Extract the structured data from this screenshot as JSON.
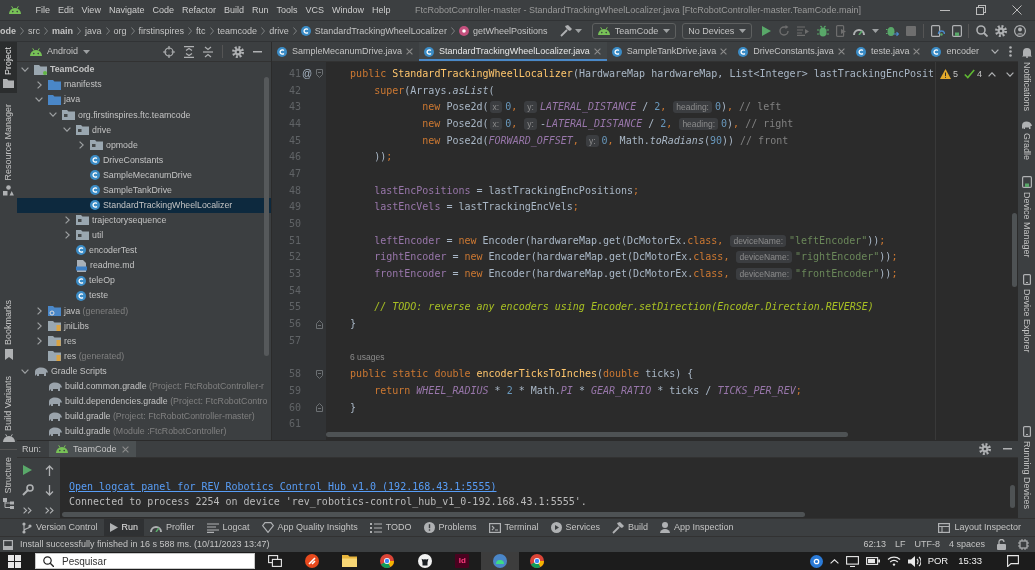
{
  "menu_bar": {
    "menus": [
      "File",
      "Edit",
      "View",
      "Navigate",
      "Code",
      "Refactor",
      "Build",
      "Run",
      "Tools",
      "VCS",
      "Window",
      "Help"
    ],
    "title": "FtcRobotController-master - StandardTrackingWheelLocalizer.java [FtcRobotController-master.TeamCode.main]"
  },
  "navigation_bar": {
    "breadcrumbs": [
      {
        "label": "ode",
        "kind": "folder",
        "bold": true
      },
      {
        "label": "src",
        "kind": "folder",
        "bold": false
      },
      {
        "label": "main",
        "kind": "folder",
        "bold": true
      },
      {
        "label": "java",
        "kind": "folder",
        "bold": false
      },
      {
        "label": "org",
        "kind": "folder",
        "bold": false
      },
      {
        "label": "firstinspires",
        "kind": "folder",
        "bold": false
      },
      {
        "label": "ftc",
        "kind": "folder",
        "bold": false
      },
      {
        "label": "teamcode",
        "kind": "folder",
        "bold": false
      },
      {
        "label": "drive",
        "kind": "folder",
        "bold": false
      },
      {
        "label": "StandardTrackingWheelLocalizer",
        "kind": "class",
        "bold": false
      },
      {
        "label": "getWheelPositions",
        "kind": "method",
        "bold": false
      }
    ],
    "run_configuration": "TeamCode",
    "device": "No Devices"
  },
  "left_stripe": {
    "top": [
      {
        "label": "Project",
        "kind": "folder",
        "selected": true
      },
      {
        "label": "Resource Manager",
        "kind": "resources",
        "selected": false
      }
    ],
    "middle": [
      {
        "label": "Bookmarks",
        "kind": "bookmark",
        "selected": false
      },
      {
        "label": "Build Variants",
        "kind": "android",
        "selected": false
      }
    ],
    "bottom": [
      {
        "label": "Structure",
        "kind": "structure",
        "selected": false
      }
    ]
  },
  "right_stripe": {
    "top": [
      {
        "label": "Notifications",
        "kind": "bell",
        "selected": false
      }
    ],
    "middle": [
      {
        "label": "Gradle",
        "kind": "gradle",
        "selected": false
      },
      {
        "label": "Device Manager",
        "kind": "device",
        "selected": false
      },
      {
        "label": "Device Explorer",
        "kind": "phone",
        "selected": false
      }
    ],
    "bottom": [
      {
        "label": "Running Devices",
        "kind": "phone",
        "selected": false
      }
    ]
  },
  "project_panel": {
    "view": "Android",
    "tree": [
      {
        "label": "TeamCode",
        "kind": "module",
        "expanded": true,
        "selected": false,
        "children": [
          {
            "label": "manifests",
            "kind": "source_folder",
            "expanded": false,
            "selected": false
          },
          {
            "label": "java",
            "kind": "source_folder",
            "expanded": true,
            "selected": false,
            "children": [
              {
                "label": "org.firstinspires.ftc.teamcode",
                "kind": "package",
                "expanded": true,
                "selected": false,
                "children": [
                  {
                    "label": "drive",
                    "kind": "package",
                    "expanded": true,
                    "selected": false,
                    "children": [
                      {
                        "label": "opmode",
                        "kind": "package",
                        "expanded": false,
                        "selected": false
                      },
                      {
                        "label": "DriveConstants",
                        "kind": "class",
                        "selected": false
                      },
                      {
                        "label": "SampleMecanumDrive",
                        "kind": "class",
                        "selected": false
                      },
                      {
                        "label": "SampleTankDrive",
                        "kind": "class",
                        "selected": false
                      },
                      {
                        "label": "StandardTrackingWheelLocalizer",
                        "kind": "class",
                        "selected": true
                      }
                    ]
                  },
                  {
                    "label": "trajectorysequence",
                    "kind": "package",
                    "expanded": false,
                    "selected": false
                  },
                  {
                    "label": "util",
                    "kind": "package",
                    "expanded": false,
                    "selected": false
                  },
                  {
                    "label": "encoderTest",
                    "kind": "class",
                    "selected": false
                  },
                  {
                    "label": "readme.md",
                    "kind": "markdown",
                    "selected": false
                  },
                  {
                    "label": "teleOp",
                    "kind": "class",
                    "selected": false
                  },
                  {
                    "label": "teste",
                    "kind": "class",
                    "selected": false
                  }
                ]
              }
            ]
          },
          {
            "label": "java",
            "note": "(generated)",
            "kind": "generated_folder",
            "expanded": false,
            "selected": false
          },
          {
            "label": "jniLibs",
            "kind": "resource_folder",
            "expanded": false,
            "selected": false
          },
          {
            "label": "res",
            "kind": "resource_folder",
            "expanded": false,
            "selected": false
          },
          {
            "label": "res",
            "note": "(generated)",
            "kind": "resource_folder",
            "selected": false
          }
        ]
      },
      {
        "label": "Gradle Scripts",
        "kind": "gradle",
        "expanded": true,
        "selected": false,
        "children": [
          {
            "label": "build.common.gradle",
            "note": "(Project: FtcRobotController-r",
            "kind": "gradle",
            "selected": false
          },
          {
            "label": "build.dependencies.gradle",
            "note": "(Project: FtcRobotContro",
            "kind": "gradle",
            "selected": false
          },
          {
            "label": "build.gradle",
            "note": "(Project: FtcRobotController-master)",
            "kind": "gradle",
            "selected": false
          },
          {
            "label": "build.gradle",
            "note": "(Module :FtcRobotController)",
            "kind": "gradle",
            "selected": false
          }
        ]
      }
    ]
  },
  "editor": {
    "tabs": [
      {
        "label": "SampleMecanumDrive.java",
        "selected": false,
        "closable": true
      },
      {
        "label": "StandardTrackingWheelLocalizer.java",
        "selected": true,
        "closable": true
      },
      {
        "label": "SampleTankDrive.java",
        "selected": false,
        "closable": true
      },
      {
        "label": "DriveConstants.java",
        "selected": false,
        "closable": true
      },
      {
        "label": "teste.java",
        "selected": false,
        "closable": true
      },
      {
        "label": "encoder",
        "selected": false,
        "closable": false
      }
    ],
    "inspections": {
      "warnings": "5",
      "typos": "4"
    },
    "lines": [
      {
        "kind": "code",
        "number": "41",
        "gutter_icon": "@",
        "fold_start": true,
        "parts": [
          {
            "kind": "keyword",
            "text": "    public "
          },
          {
            "kind": "method",
            "text": "StandardTrackingWheelLocalizer"
          },
          {
            "kind": "plain",
            "text": "(HardwareMap hardwareMap, List<Integer> lastTrackingEncPosit"
          }
        ]
      },
      {
        "kind": "code",
        "number": "42",
        "parts": [
          {
            "kind": "keyword",
            "text": "        super"
          },
          {
            "kind": "plain",
            "text": "(Arrays."
          },
          {
            "kind": "italic",
            "text": "asList"
          },
          {
            "kind": "plain",
            "text": "("
          }
        ]
      },
      {
        "kind": "code",
        "number": "43",
        "parts": [
          {
            "kind": "keyword",
            "text": "                new"
          },
          {
            "kind": "plain",
            "text": " Pose2d("
          },
          {
            "kind": "hint",
            "text": "x:"
          },
          {
            "kind": "number",
            "text": "0"
          },
          {
            "kind": "punct",
            "text": ", "
          },
          {
            "kind": "hint",
            "text": "y:"
          },
          {
            "kind": "constant",
            "text": "LATERAL_DISTANCE"
          },
          {
            "kind": "plain",
            "text": " / "
          },
          {
            "kind": "number",
            "text": "2"
          },
          {
            "kind": "punct",
            "text": ", "
          },
          {
            "kind": "hint",
            "text": "heading:"
          },
          {
            "kind": "number",
            "text": "0"
          },
          {
            "kind": "plain",
            "text": ")"
          },
          {
            "kind": "punct",
            "text": ","
          },
          {
            "kind": "comment",
            "text": " // left"
          }
        ]
      },
      {
        "kind": "code",
        "number": "44",
        "parts": [
          {
            "kind": "keyword",
            "text": "                new"
          },
          {
            "kind": "plain",
            "text": " Pose2d("
          },
          {
            "kind": "hint",
            "text": "x:"
          },
          {
            "kind": "number",
            "text": "0"
          },
          {
            "kind": "punct",
            "text": ", "
          },
          {
            "kind": "hint",
            "text": "y:"
          },
          {
            "kind": "plain",
            "text": "-"
          },
          {
            "kind": "constant",
            "text": "LATERAL_DISTANCE"
          },
          {
            "kind": "plain",
            "text": " / "
          },
          {
            "kind": "number",
            "text": "2"
          },
          {
            "kind": "punct",
            "text": ", "
          },
          {
            "kind": "hint",
            "text": "heading:"
          },
          {
            "kind": "number",
            "text": "0"
          },
          {
            "kind": "plain",
            "text": ")"
          },
          {
            "kind": "punct",
            "text": ","
          },
          {
            "kind": "comment",
            "text": " // right"
          }
        ]
      },
      {
        "kind": "code",
        "number": "45",
        "parts": [
          {
            "kind": "keyword",
            "text": "                new"
          },
          {
            "kind": "plain",
            "text": " Pose2d("
          },
          {
            "kind": "constant",
            "text": "FORWARD_OFFSET"
          },
          {
            "kind": "punct",
            "text": ", "
          },
          {
            "kind": "hint",
            "text": "y:"
          },
          {
            "kind": "number",
            "text": "0"
          },
          {
            "kind": "punct",
            "text": ","
          },
          {
            "kind": "plain",
            "text": " Math."
          },
          {
            "kind": "italic",
            "text": "toRadians"
          },
          {
            "kind": "plain",
            "text": "("
          },
          {
            "kind": "number",
            "text": "90"
          },
          {
            "kind": "plain",
            "text": "))"
          },
          {
            "kind": "comment",
            "text": " // front"
          }
        ]
      },
      {
        "kind": "code",
        "number": "46",
        "parts": [
          {
            "kind": "plain",
            "text": "        ))"
          },
          {
            "kind": "punct",
            "text": ";"
          }
        ]
      },
      {
        "kind": "code",
        "number": "47"
      },
      {
        "kind": "code",
        "number": "48",
        "parts": [
          {
            "kind": "field",
            "text": "        lastEncPositions"
          },
          {
            "kind": "plain",
            "text": " = lastTrackingEncPositions"
          },
          {
            "kind": "punct",
            "text": ";"
          }
        ]
      },
      {
        "kind": "code",
        "number": "49",
        "parts": [
          {
            "kind": "field",
            "text": "        lastEncVels"
          },
          {
            "kind": "plain",
            "text": " = lastTrackingEncVels"
          },
          {
            "kind": "punct",
            "text": ";"
          }
        ]
      },
      {
        "kind": "code",
        "number": "50"
      },
      {
        "kind": "code",
        "number": "51",
        "parts": [
          {
            "kind": "field",
            "text": "        leftEncoder"
          },
          {
            "kind": "plain",
            "text": " = "
          },
          {
            "kind": "keyword",
            "text": "new"
          },
          {
            "kind": "plain",
            "text": " Encoder(hardwareMap.get(DcMotorEx."
          },
          {
            "kind": "keyword",
            "text": "class"
          },
          {
            "kind": "punct",
            "text": ", "
          },
          {
            "kind": "hint",
            "text": "deviceName:"
          },
          {
            "kind": "string",
            "text": "\"leftEncoder\""
          },
          {
            "kind": "plain",
            "text": "))"
          },
          {
            "kind": "punct",
            "text": ";"
          }
        ]
      },
      {
        "kind": "code",
        "number": "52",
        "parts": [
          {
            "kind": "field",
            "text": "        rightEncoder"
          },
          {
            "kind": "plain",
            "text": " = "
          },
          {
            "kind": "keyword",
            "text": "new"
          },
          {
            "kind": "plain",
            "text": " Encoder(hardwareMap.get(DcMotorEx."
          },
          {
            "kind": "keyword",
            "text": "class"
          },
          {
            "kind": "punct",
            "text": ", "
          },
          {
            "kind": "hint",
            "text": "deviceName:"
          },
          {
            "kind": "string",
            "text": "\"rightEncoder\""
          },
          {
            "kind": "plain",
            "text": "))"
          },
          {
            "kind": "punct",
            "text": ";"
          }
        ]
      },
      {
        "kind": "code",
        "number": "53",
        "parts": [
          {
            "kind": "field",
            "text": "        frontEncoder"
          },
          {
            "kind": "plain",
            "text": " = "
          },
          {
            "kind": "keyword",
            "text": "new"
          },
          {
            "kind": "plain",
            "text": " Encoder(hardwareMap.get(DcMotorEx."
          },
          {
            "kind": "keyword",
            "text": "class"
          },
          {
            "kind": "punct",
            "text": ", "
          },
          {
            "kind": "hint",
            "text": "deviceName:"
          },
          {
            "kind": "string",
            "text": "\"frontEncoder\""
          },
          {
            "kind": "plain",
            "text": "))"
          },
          {
            "kind": "punct",
            "text": ";"
          }
        ]
      },
      {
        "kind": "code",
        "number": "54"
      },
      {
        "kind": "code",
        "number": "55",
        "parts": [
          {
            "kind": "todo",
            "text": "        // TODO: reverse any encoders using Encoder.setDirection(Encoder.Direction.REVERSE)"
          }
        ]
      },
      {
        "kind": "code",
        "number": "56",
        "fold_end": true,
        "parts": [
          {
            "kind": "plain",
            "text": "    }"
          }
        ]
      },
      {
        "kind": "code",
        "number": "57"
      },
      {
        "kind": "usages",
        "text": "6 usages"
      },
      {
        "kind": "code",
        "number": "58",
        "fold_start": true,
        "parts": [
          {
            "kind": "keyword",
            "text": "    public static double "
          },
          {
            "kind": "method",
            "text": "encoderTicksToInches"
          },
          {
            "kind": "plain",
            "text": "("
          },
          {
            "kind": "keyword",
            "text": "double"
          },
          {
            "kind": "plain",
            "text": " ticks) {"
          }
        ]
      },
      {
        "kind": "code",
        "number": "59",
        "parts": [
          {
            "kind": "keyword",
            "text": "        return "
          },
          {
            "kind": "constant",
            "text": "WHEEL_RADIUS"
          },
          {
            "kind": "plain",
            "text": " * "
          },
          {
            "kind": "number",
            "text": "2"
          },
          {
            "kind": "plain",
            "text": " * Math."
          },
          {
            "kind": "constant",
            "text": "PI"
          },
          {
            "kind": "plain",
            "text": " * "
          },
          {
            "kind": "constant",
            "text": "GEAR_RATIO"
          },
          {
            "kind": "plain",
            "text": " * ticks / "
          },
          {
            "kind": "constant",
            "text": "TICKS_PER_REV"
          },
          {
            "kind": "punct",
            "text": ";"
          }
        ]
      },
      {
        "kind": "code",
        "number": "60",
        "fold_end": true,
        "parts": [
          {
            "kind": "plain",
            "text": "    }"
          }
        ]
      },
      {
        "kind": "code",
        "number": "61"
      }
    ]
  },
  "run_panel": {
    "title": "Run:",
    "tabs": [
      {
        "label": "TeamCode",
        "selected": true
      }
    ],
    "console": [
      {
        "kind": "link",
        "text": "Open logcat panel for REV Robotics Control Hub v1.0 (192.168.43.1:5555)"
      },
      {
        "kind": "output",
        "text": "Connected to process 2254 on device 'rev_robotics-control_hub_v1_0-192.168.43.1:5555'."
      }
    ]
  },
  "tool_windows": {
    "left": [
      {
        "label": "Version Control",
        "kind": "vcs",
        "selected": false
      },
      {
        "label": "Run",
        "kind": "run",
        "selected": true
      },
      {
        "label": "Profiler",
        "kind": "profiler",
        "selected": false
      },
      {
        "label": "Logcat",
        "kind": "logcat",
        "selected": false
      },
      {
        "label": "App Quality Insights",
        "kind": "insights",
        "selected": false
      },
      {
        "label": "TODO",
        "kind": "todo",
        "selected": false
      },
      {
        "label": "Problems",
        "kind": "problems",
        "selected": false
      },
      {
        "label": "Terminal",
        "kind": "terminal",
        "selected": false
      },
      {
        "label": "Services",
        "kind": "services",
        "selected": false
      },
      {
        "label": "Build",
        "kind": "build",
        "selected": false
      },
      {
        "label": "App Inspection",
        "kind": "inspection",
        "selected": false
      }
    ],
    "right": [
      {
        "label": "Layout Inspector",
        "kind": "layout",
        "selected": false
      }
    ]
  },
  "status_bar": {
    "message": "Install successfully finished in 16 s 588 ms. (10/11/2023 13:47)",
    "caret_position": "62:13",
    "line_separator": "LF",
    "encoding": "UTF-8",
    "indentation": "4 spaces"
  },
  "taskbar": {
    "search": {
      "placeholder": "Pesquisar"
    },
    "apps": [
      {
        "kind": "task_view",
        "selected": false
      },
      {
        "kind": "red_app",
        "selected": false
      },
      {
        "kind": "folder",
        "selected": false
      },
      {
        "kind": "browser",
        "selected": false
      },
      {
        "kind": "github",
        "selected": false
      },
      {
        "kind": "tile",
        "label": "Id",
        "selected": false
      },
      {
        "kind": "android_studio",
        "selected": true
      },
      {
        "kind": "browser",
        "selected": false
      }
    ],
    "language": "POR",
    "time": "15:33"
  }
}
